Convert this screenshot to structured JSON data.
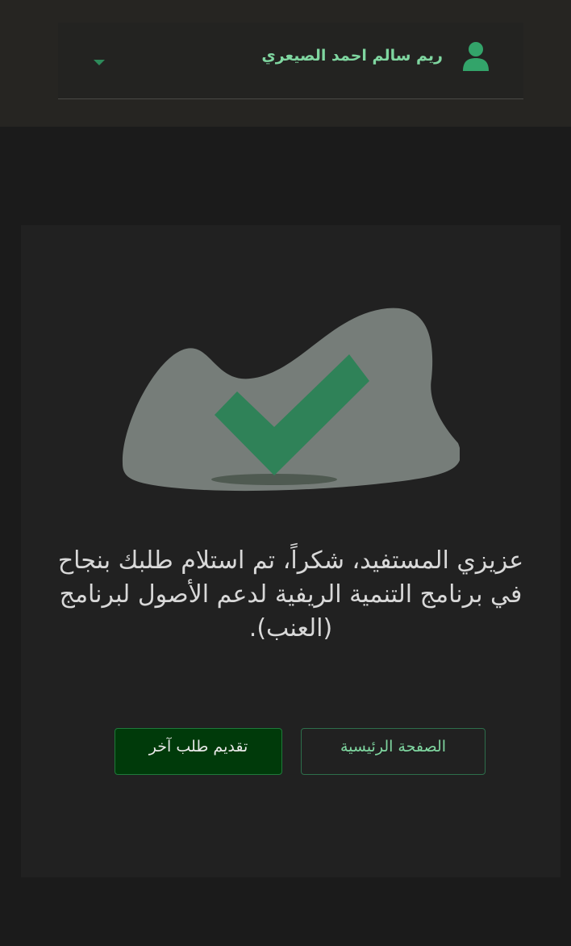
{
  "header": {
    "user_name": "ريم سالم احمد الصيعري"
  },
  "confirmation": {
    "message": "عزيزي المستفيد، شكراً، تم استلام طلبك بنجاح في برنامج التنمية الريفية لدعم الأصول لبرنامج (العنب)."
  },
  "actions": {
    "home_label": "الصفحة الرئيسية",
    "new_request_label": "تقديم طلب آخر"
  },
  "colors": {
    "accent": "#2d8a5a",
    "primary_button": "#003a0a",
    "blob": "#767d79"
  }
}
